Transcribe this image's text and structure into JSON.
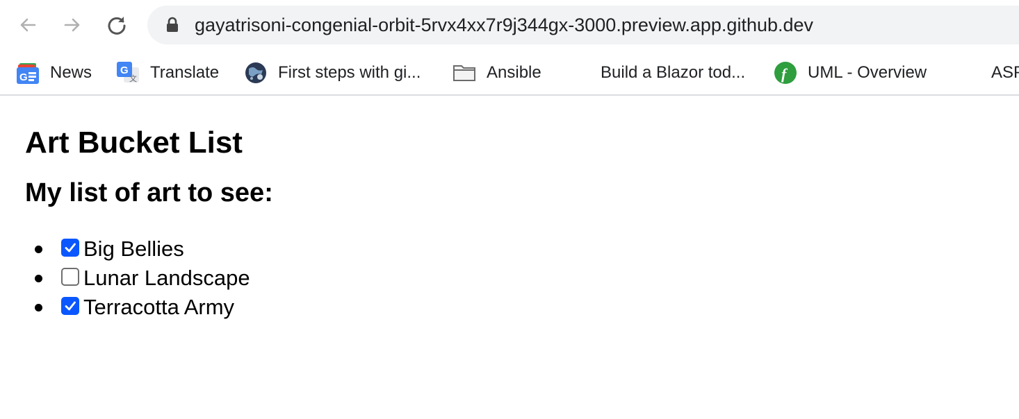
{
  "browser": {
    "url": "gayatrisoni-congenial-orbit-5rvx4xx7r9j344gx-3000.preview.app.github.dev",
    "nav": {
      "back_icon": "back-arrow-icon",
      "forward_icon": "forward-arrow-icon",
      "reload_icon": "reload-icon",
      "lock_icon": "lock-icon"
    },
    "bookmarks": [
      {
        "label": "News",
        "icon": "google-news-icon"
      },
      {
        "label": "Translate",
        "icon": "google-translate-icon"
      },
      {
        "label": "First steps with gi...",
        "icon": "globe-icon"
      },
      {
        "label": "Ansible",
        "icon": "folder-icon"
      },
      {
        "label": "Build a Blazor tod...",
        "icon": "microsoft-logo-icon"
      },
      {
        "label": "UML - Overview",
        "icon": "uml-logo-icon"
      },
      {
        "label": "ASP",
        "icon": "microsoft-logo-icon"
      }
    ]
  },
  "page": {
    "title": "Art Bucket List",
    "subtitle": "My list of art to see:",
    "items": [
      {
        "name": "Big Bellies",
        "seen": true
      },
      {
        "name": "Lunar Landscape",
        "seen": false
      },
      {
        "name": "Terracotta Army",
        "seen": true
      }
    ]
  },
  "colors": {
    "checkbox_checked": "#0b57ff",
    "omnibox_bg": "#f1f3f4"
  }
}
